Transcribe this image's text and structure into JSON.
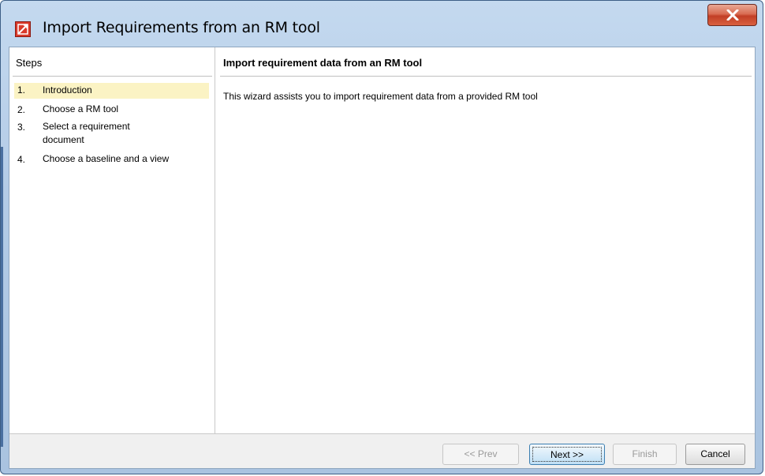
{
  "window": {
    "title": "Import Requirements from an RM tool",
    "icon": "app-logo-icon",
    "close_icon": "close-icon"
  },
  "steps": {
    "header": "Steps",
    "items": [
      {
        "num": "1.",
        "label": "Introduction",
        "active": true
      },
      {
        "num": "2.",
        "label": "Choose a RM tool",
        "active": false
      },
      {
        "num": "3.",
        "label": "Select a requirement document",
        "active": false
      },
      {
        "num": "4.",
        "label": "Choose a baseline and a view",
        "active": false
      }
    ]
  },
  "content": {
    "title": "Import requirement data from an RM tool",
    "description": "This wizard assists you to import requirement data from a provided RM tool"
  },
  "buttons": {
    "prev": "<< Prev",
    "next": "Next >>",
    "finish": "Finish",
    "cancel": "Cancel"
  },
  "colors": {
    "active_step_bg": "#fbf3c4",
    "close_button": "#c9452c",
    "title_bar": "#b3cbe6"
  }
}
